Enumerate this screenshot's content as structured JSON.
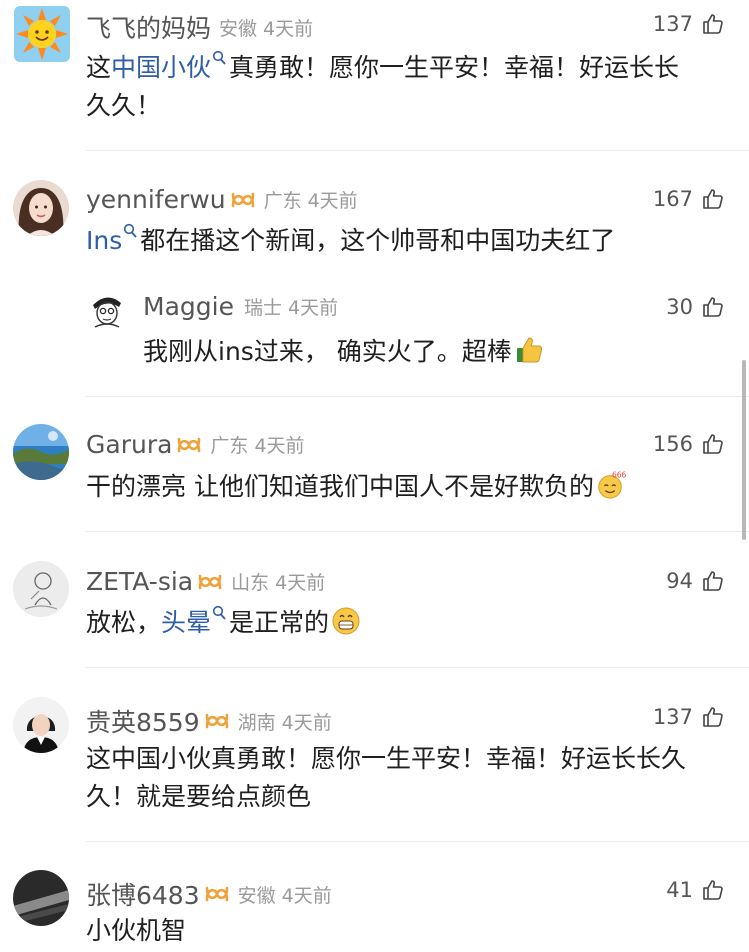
{
  "comments": [
    {
      "username": "飞飞的妈妈",
      "location": "安徽",
      "time": "4天前",
      "likes": "137",
      "text_parts": [
        "这",
        "中国小伙",
        "真勇敢！愿你一生平安！幸福！好运长长",
        "久久！"
      ]
    },
    {
      "username": "yenniferwu",
      "location": "广东",
      "time": "4天前",
      "likes": "167",
      "text_parts": [
        "Ins",
        "都在播这个新闻，这个帅哥和中国功夫红了"
      ]
    },
    {
      "username": "Maggie",
      "location": "瑞士",
      "time": "4天前",
      "likes": "30",
      "text_parts": [
        "我刚从ins过来，  确实火了。超棒"
      ]
    },
    {
      "username": "Garura",
      "location": "广东",
      "time": "4天前",
      "likes": "156",
      "text_parts": [
        "干的漂亮 让他们知道我们中国人不是好欺负的"
      ],
      "emoji_text": "666"
    },
    {
      "username": "ZETA-sia",
      "location": "山东",
      "time": "4天前",
      "likes": "94",
      "text_parts": [
        "放松，",
        "头晕",
        "是正常的"
      ]
    },
    {
      "username": "贵英8559",
      "location": "湖南",
      "time": "4天前",
      "likes": "137",
      "text_parts": [
        "这中国小伙真勇敢！愿你一生平安！幸福！好运长长久",
        "久！就是要给点颜色"
      ]
    },
    {
      "username": "张博6483",
      "location": "安徽",
      "time": "4天前",
      "likes": "41",
      "text_parts": [
        "小伙机智"
      ]
    }
  ],
  "colors": {
    "link": "#2f5ea8",
    "badge": "#f0a23a",
    "meta": "#9a9a9a"
  }
}
